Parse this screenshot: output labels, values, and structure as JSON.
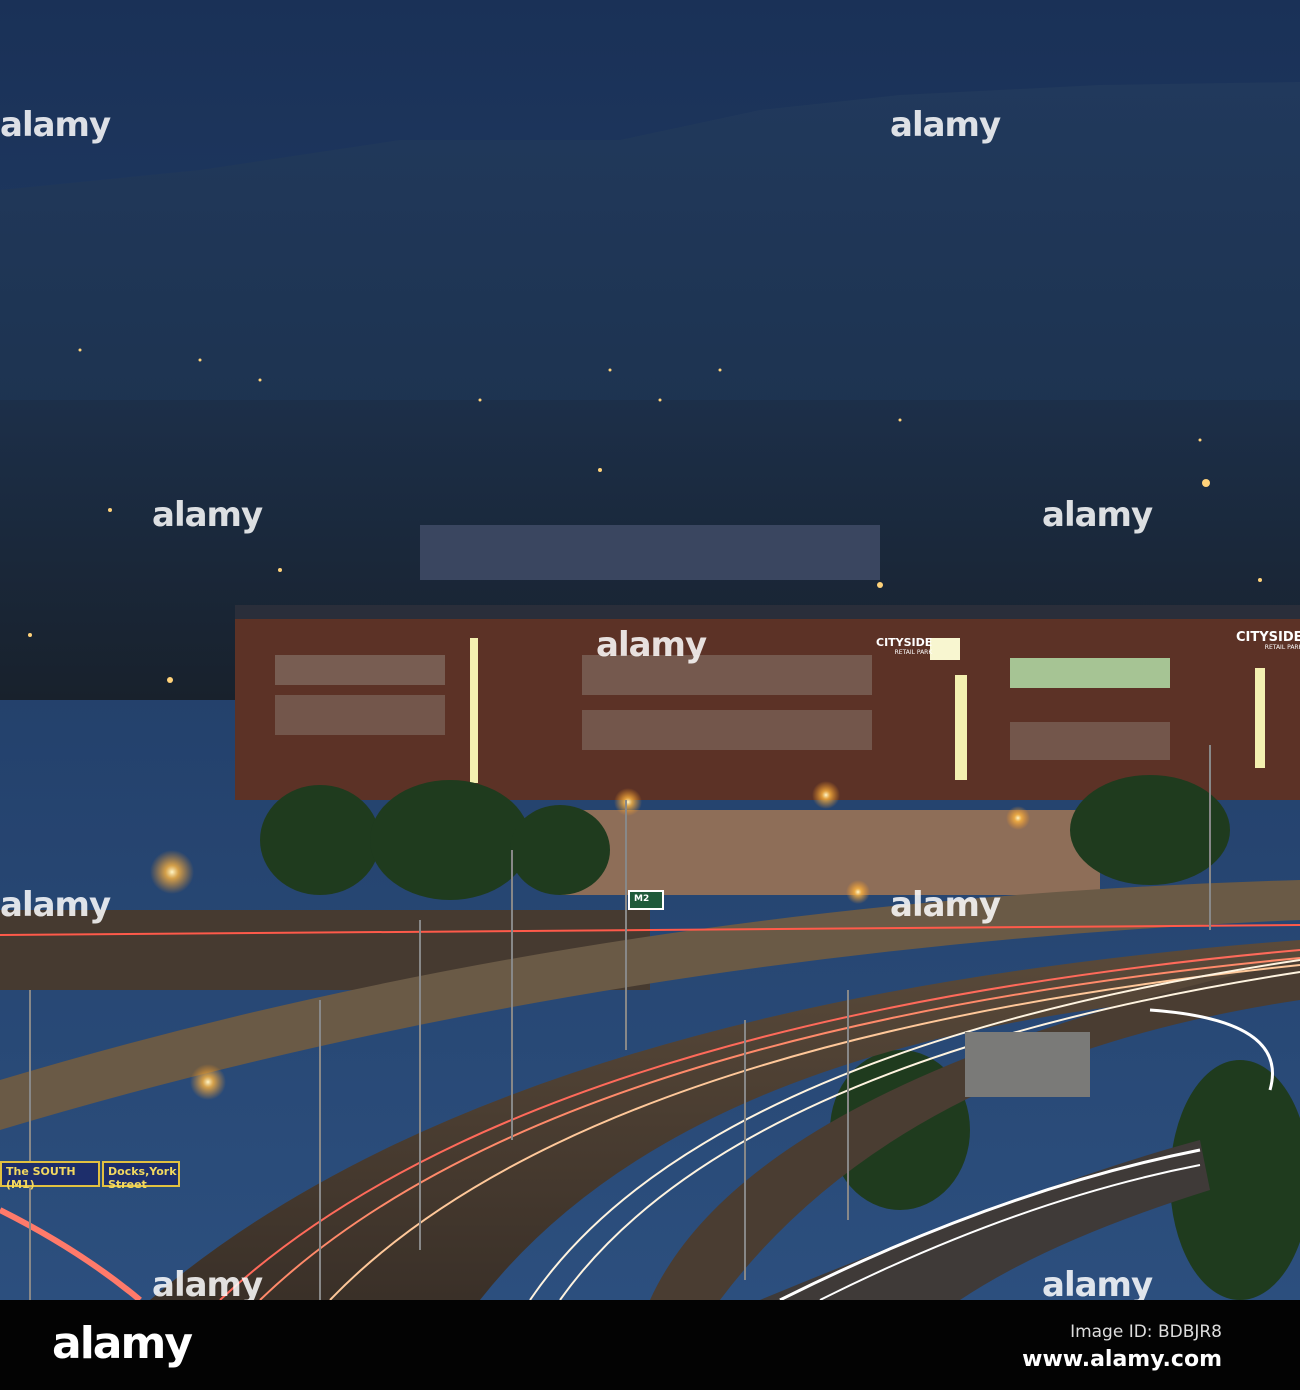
{
  "photo": {
    "watermark": "alamy",
    "building_sign": {
      "name": "CITYSIDE",
      "subtitle": "RETAIL PARK"
    },
    "road_signs": [
      "The SOUTH (M1)",
      "Docks,York Street",
      "M2"
    ]
  },
  "footer": {
    "logo": "alamy",
    "image_id": "Image ID: BDBJR8",
    "website": "www.alamy.com"
  }
}
